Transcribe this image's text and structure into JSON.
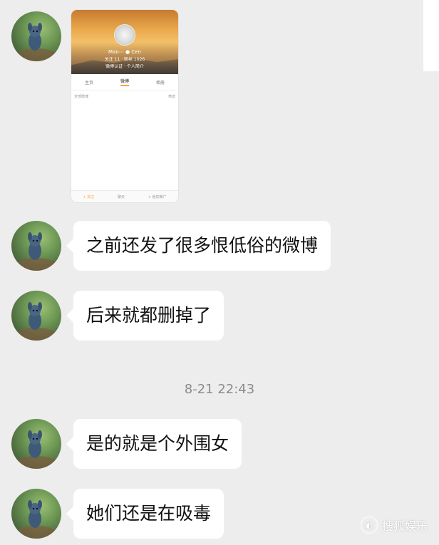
{
  "image_message": {
    "profile_name": "Man⋯ ● Cen",
    "stats": "关注 11  ·  粉丝 1026",
    "description": "微博认证 · 个人简介",
    "tabs": [
      "主页",
      "微博",
      "相册"
    ],
    "active_tab": 1,
    "filter_left": "全部微博",
    "filter_right": "筛选",
    "bottom_bar": [
      "+ 关注",
      "聊天",
      "+ 他的推广"
    ]
  },
  "messages": [
    {
      "text": "之前还发了很多恨低俗的微博"
    },
    {
      "text": "后来就都删掉了"
    },
    {
      "text": "是的就是个外围女"
    },
    {
      "text": "她们还是在吸毒"
    }
  ],
  "timestamp": "8-21 22:43",
  "watermark": {
    "icon": "sohu-fox-icon",
    "text": "搜狐娱乐"
  },
  "colors": {
    "background": "#ededed",
    "bubble": "#ffffff",
    "timestamp": "#8c8c8c"
  }
}
